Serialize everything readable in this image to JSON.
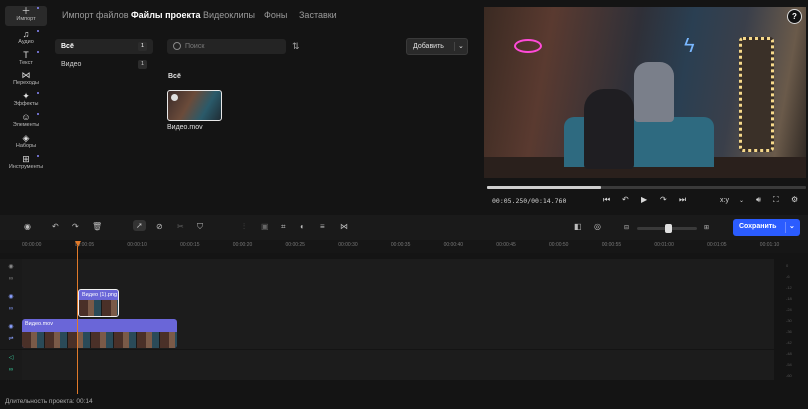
{
  "sidebar": {
    "items": [
      {
        "label": "Импорт",
        "icon": "plus-icon"
      },
      {
        "label": "Аудио",
        "icon": "music-note-icon"
      },
      {
        "label": "Текст",
        "icon": "text-icon"
      },
      {
        "label": "Переходы",
        "icon": "transition-icon"
      },
      {
        "label": "Эффекты",
        "icon": "sparkle-icon"
      },
      {
        "label": "Элементы",
        "icon": "sticker-icon"
      },
      {
        "label": "Наборы",
        "icon": "layers-icon"
      },
      {
        "label": "Инструменты",
        "icon": "tools-icon"
      }
    ]
  },
  "tabs": [
    "Импорт файлов",
    "Файлы проекта",
    "Видеоклипы",
    "Фоны",
    "Заставки"
  ],
  "file_list": [
    {
      "label": "Всё",
      "count": "1"
    },
    {
      "label": "Видео",
      "count": "1"
    }
  ],
  "search": {
    "placeholder": "Поиск"
  },
  "add_button": {
    "label": "Добавить"
  },
  "grid": {
    "heading": "Всё",
    "file_name": "Видео.mov"
  },
  "player": {
    "timecode": "00:05.250/00:14.760",
    "progress": 0.356,
    "aspect_label": "x:y",
    "help": "?"
  },
  "toolbar": {
    "save_label": "Сохранить"
  },
  "ruler": [
    "00:00:00",
    "00:00:05",
    "00:00:10",
    "00:00:15",
    "00:00:20",
    "00:00:25",
    "00:00:30",
    "00:00:35",
    "00:00:40",
    "00:00:45",
    "00:00:50",
    "00:00:55",
    "00:01:00",
    "00:01:05",
    "00:01:10"
  ],
  "clips": {
    "video": "Видео.mov",
    "image": "Видео (1).png"
  },
  "meter": [
    "0",
    "-6",
    "-12",
    "-18",
    "-24",
    "-30",
    "-36",
    "-42",
    "-48",
    "-54",
    "-60"
  ],
  "status": {
    "duration": "Длительность проекта: 00:14"
  },
  "colors": {
    "accent": "#2b5cff",
    "playhead": "#e07a2a",
    "clip": "#6a66d8"
  }
}
